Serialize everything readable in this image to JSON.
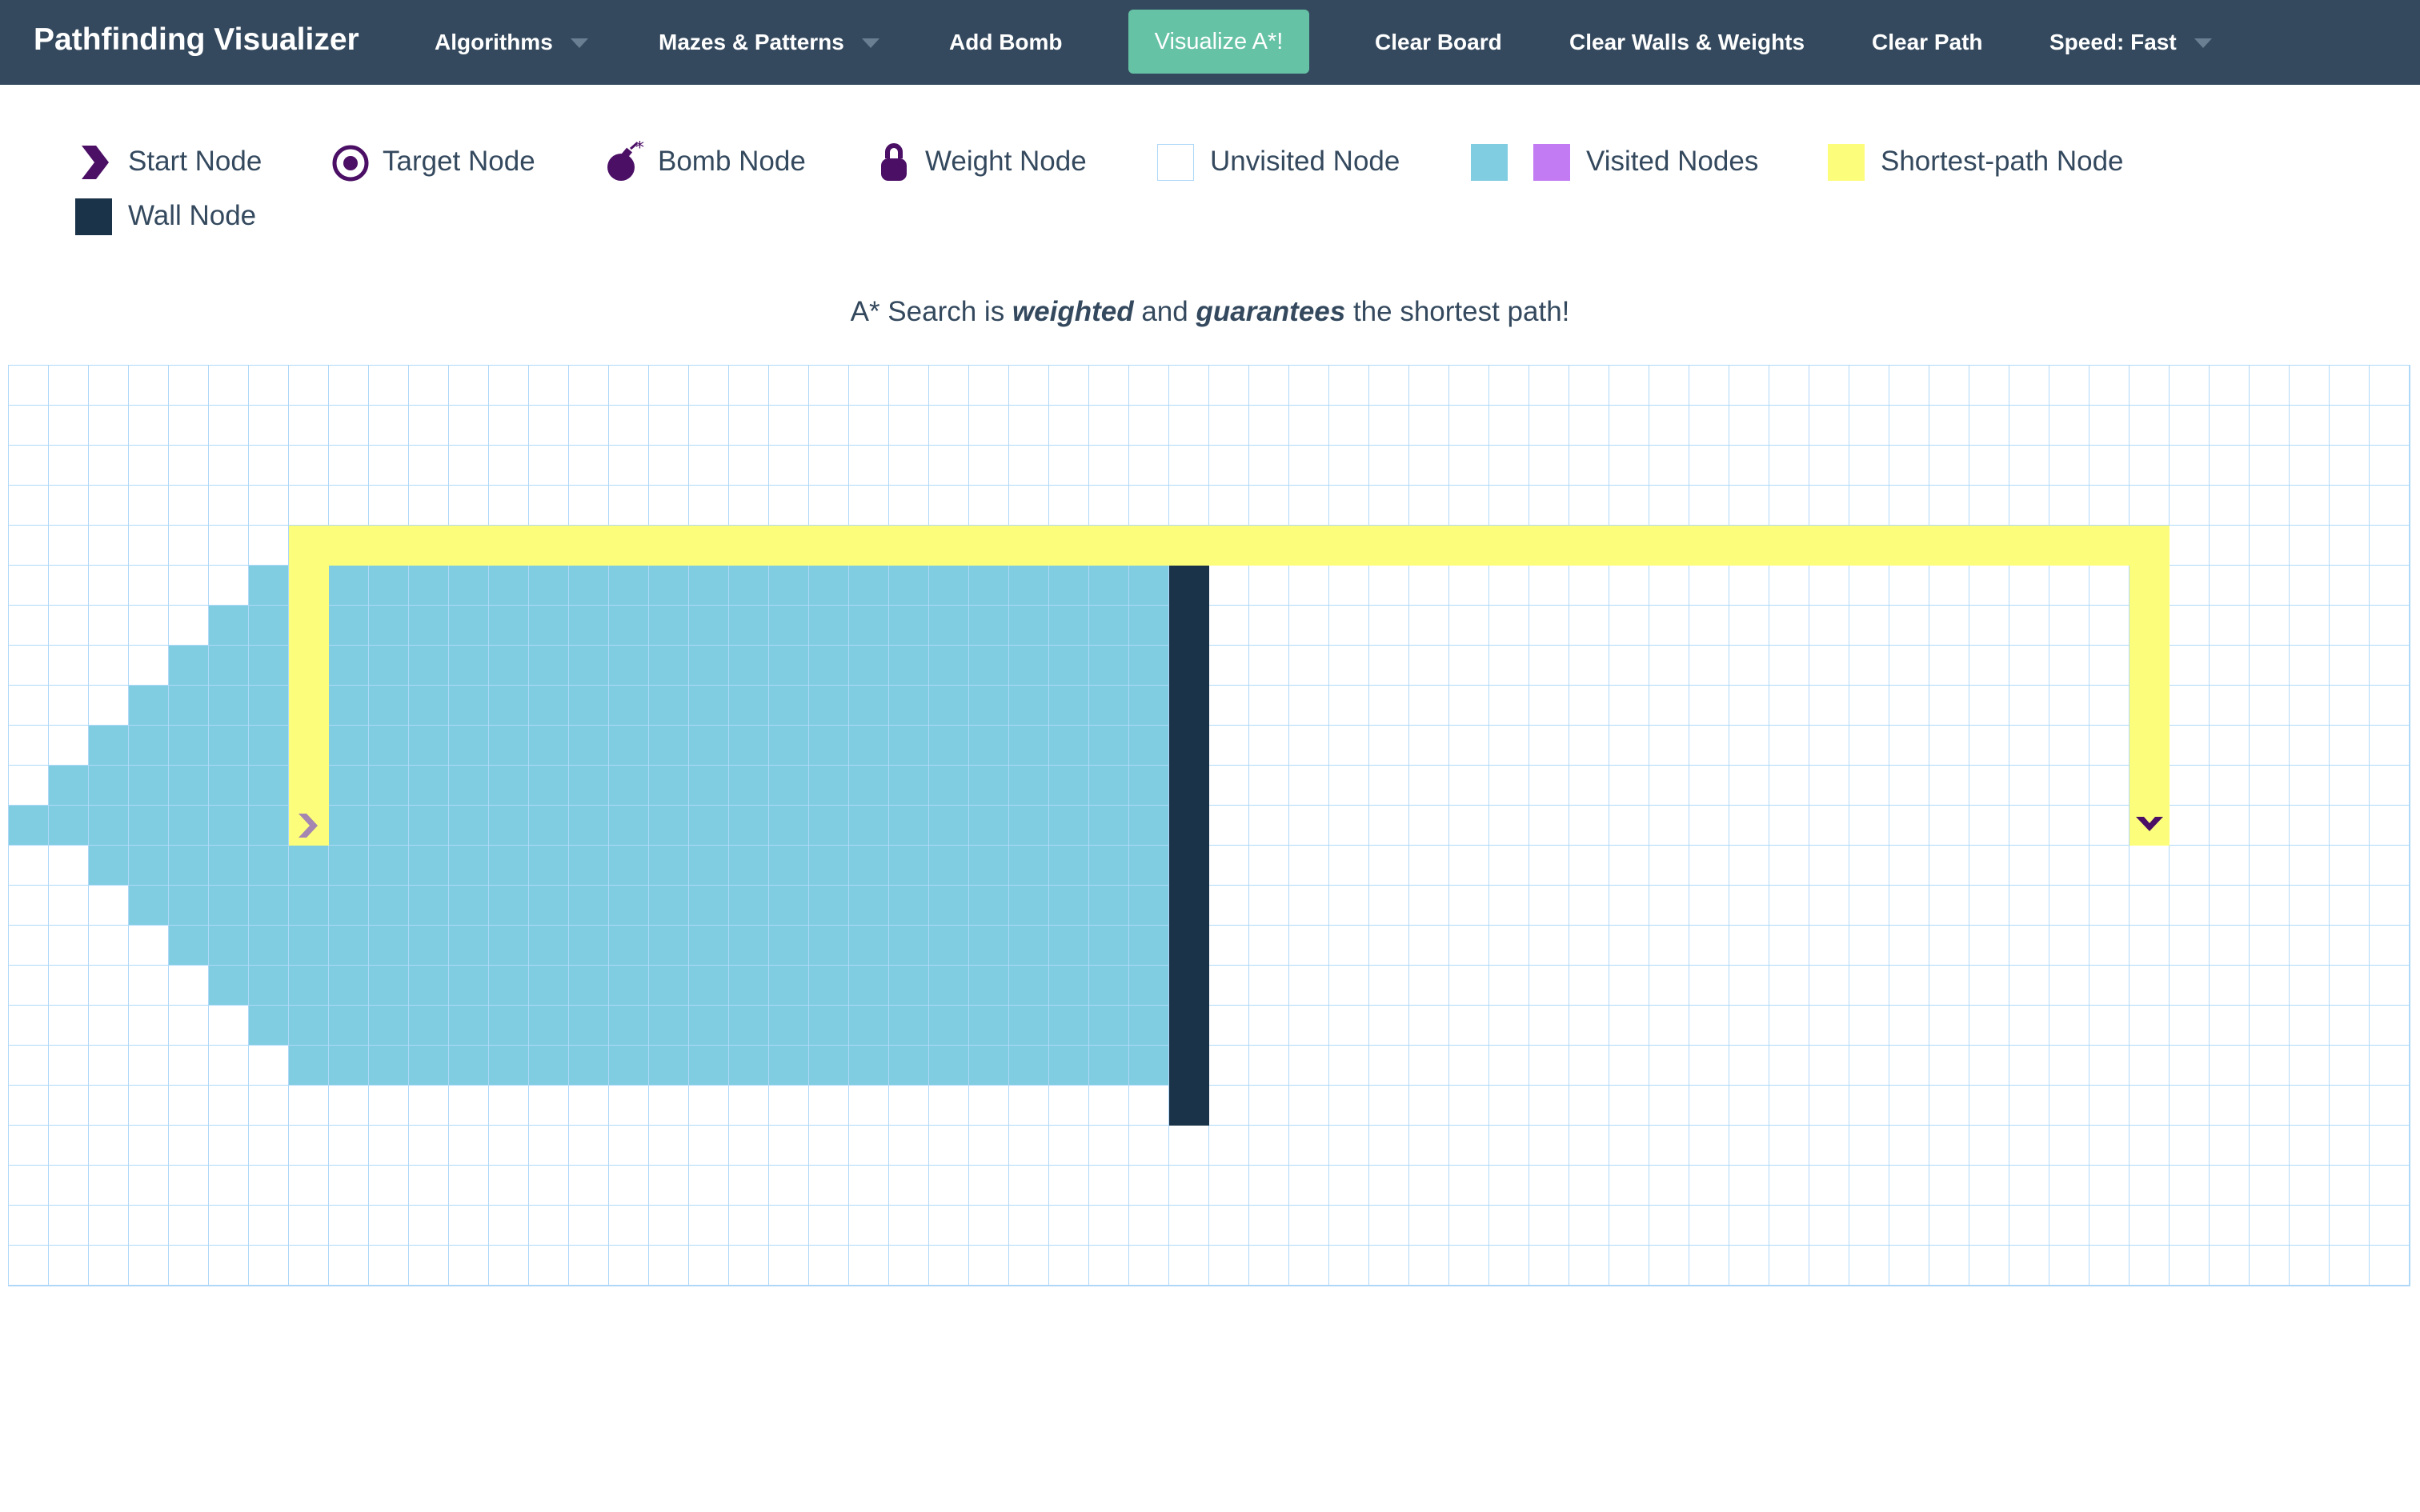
{
  "app": {
    "brand": "Pathfinding Visualizer"
  },
  "nav": {
    "algorithms": "Algorithms",
    "mazes": "Mazes & Patterns",
    "add_bomb": "Add Bomb",
    "visualize": "Visualize A*!",
    "clear_board": "Clear Board",
    "clear_walls": "Clear Walls & Weights",
    "clear_path": "Clear Path",
    "speed": "Speed: Fast"
  },
  "legend": {
    "start": "Start Node",
    "target": "Target Node",
    "bomb": "Bomb Node",
    "weight": "Weight Node",
    "unvisited": "Unvisited Node",
    "visited": "Visited Nodes",
    "shortest": "Shortest-path Node",
    "wall": "Wall Node"
  },
  "description": {
    "prefix": "A* Search is ",
    "em1": "weighted",
    "mid": " and ",
    "em2": "guarantees",
    "suffix": " the shortest path!"
  },
  "colors": {
    "navbar": "#34495e",
    "visualize_button": "#66c2a5",
    "grid_line": "#afd8f8",
    "visited": "#80cce0",
    "visited_alt": "#c27bf2",
    "shortest_path": "#fdfd7c",
    "wall": "#1a3348",
    "node_icon": "#4b0f65"
  },
  "grid": {
    "cols": 60,
    "rows": 23,
    "start": {
      "row": 11,
      "col": 7
    },
    "target": {
      "row": 11,
      "col": 53
    },
    "wall_cells": [
      [
        5,
        29
      ],
      [
        6,
        29
      ],
      [
        7,
        29
      ],
      [
        8,
        29
      ],
      [
        9,
        29
      ],
      [
        10,
        29
      ],
      [
        11,
        29
      ],
      [
        12,
        29
      ],
      [
        13,
        29
      ],
      [
        14,
        29
      ],
      [
        15,
        29
      ],
      [
        16,
        29
      ],
      [
        17,
        29
      ],
      [
        18,
        29
      ]
    ],
    "visited_row_ranges": [
      [
        5,
        6,
        28
      ],
      [
        6,
        5,
        28
      ],
      [
        7,
        4,
        28
      ],
      [
        8,
        3,
        28
      ],
      [
        9,
        2,
        28
      ],
      [
        10,
        1,
        28
      ],
      [
        11,
        0,
        28
      ],
      [
        12,
        2,
        28
      ],
      [
        13,
        3,
        28
      ],
      [
        14,
        4,
        28
      ],
      [
        15,
        5,
        28
      ],
      [
        16,
        6,
        28
      ],
      [
        17,
        7,
        28
      ]
    ],
    "path_cells": [
      [
        11,
        7
      ],
      [
        10,
        7
      ],
      [
        9,
        7
      ],
      [
        8,
        7
      ],
      [
        7,
        7
      ],
      [
        6,
        7
      ],
      [
        5,
        7
      ],
      [
        4,
        7
      ],
      [
        4,
        8
      ],
      [
        4,
        9
      ],
      [
        4,
        10
      ],
      [
        4,
        11
      ],
      [
        4,
        12
      ],
      [
        4,
        13
      ],
      [
        4,
        14
      ],
      [
        4,
        15
      ],
      [
        4,
        16
      ],
      [
        4,
        17
      ],
      [
        4,
        18
      ],
      [
        4,
        19
      ],
      [
        4,
        20
      ],
      [
        4,
        21
      ],
      [
        4,
        22
      ],
      [
        4,
        23
      ],
      [
        4,
        24
      ],
      [
        4,
        25
      ],
      [
        4,
        26
      ],
      [
        4,
        27
      ],
      [
        4,
        28
      ],
      [
        4,
        29
      ],
      [
        4,
        30
      ],
      [
        4,
        31
      ],
      [
        4,
        32
      ],
      [
        4,
        33
      ],
      [
        4,
        34
      ],
      [
        4,
        35
      ],
      [
        4,
        36
      ],
      [
        4,
        37
      ],
      [
        4,
        38
      ],
      [
        4,
        39
      ],
      [
        4,
        40
      ],
      [
        4,
        41
      ],
      [
        4,
        42
      ],
      [
        4,
        43
      ],
      [
        4,
        44
      ],
      [
        4,
        45
      ],
      [
        4,
        46
      ],
      [
        4,
        47
      ],
      [
        4,
        48
      ],
      [
        4,
        49
      ],
      [
        4,
        50
      ],
      [
        4,
        51
      ],
      [
        4,
        52
      ],
      [
        4,
        53
      ],
      [
        5,
        53
      ],
      [
        6,
        53
      ],
      [
        7,
        53
      ],
      [
        8,
        53
      ],
      [
        9,
        53
      ],
      [
        10,
        53
      ],
      [
        11,
        53
      ]
    ]
  }
}
